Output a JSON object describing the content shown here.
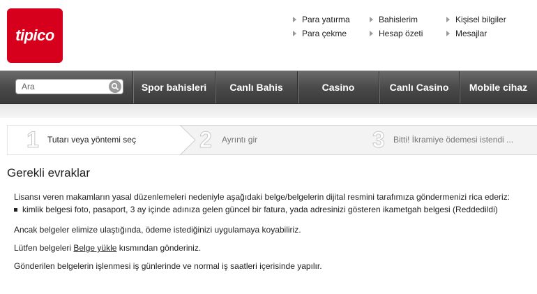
{
  "logo": {
    "text": "tipico"
  },
  "account_links": [
    {
      "label": "Para yatırma"
    },
    {
      "label": "Bahislerim"
    },
    {
      "label": "Kişisel bilgiler"
    },
    {
      "label": "Para çekme"
    },
    {
      "label": "Hesap özeti"
    },
    {
      "label": "Mesajlar"
    }
  ],
  "search": {
    "placeholder": "Ara"
  },
  "nav": [
    {
      "label": "Spor bahisleri"
    },
    {
      "label": "Canlı Bahis"
    },
    {
      "label": "Casino"
    },
    {
      "label": "Canlı Casino"
    },
    {
      "label": "Mobile cihaz"
    }
  ],
  "steps": [
    {
      "num": "1",
      "label": "Tutarı veya yöntemi seç",
      "active": true
    },
    {
      "num": "2",
      "label": "Ayrıntı gir",
      "active": false
    },
    {
      "num": "3",
      "label": "Bitti! İkramiye ödemesi istendi ...",
      "active": false
    }
  ],
  "content": {
    "title": "Gerekli evraklar",
    "intro": "Lisansı veren makamların yasal düzenlemeleri nedeniyle aşağıdaki belge/belgelerin dijital resmini tarafımıza göndermenizi rica ederiz:",
    "documents": [
      {
        "text": "kimlik belgesi foto, pasaport, 3 ay içinde adınıza gelen güncel bir fatura, yada adresinizi gösteren ikametgah belgesi (Reddedildi)"
      }
    ],
    "paragraph1": "Ancak belgeler elimize ulaştığında, ödeme istediğinizi uygulamaya koyabiliriz.",
    "paragraph2_before": "Lütfen belgeleri ",
    "paragraph2_link": "Belge yükle",
    "paragraph2_after": " kısmından gönderiniz.",
    "paragraph3": "Gönderilen belgelerin işlenmesi iş günlerinde ve normal iş saatleri içerisinde yapılır."
  },
  "colors": {
    "brand": "#d6001c",
    "nav_bg": "#4a4a4a"
  }
}
